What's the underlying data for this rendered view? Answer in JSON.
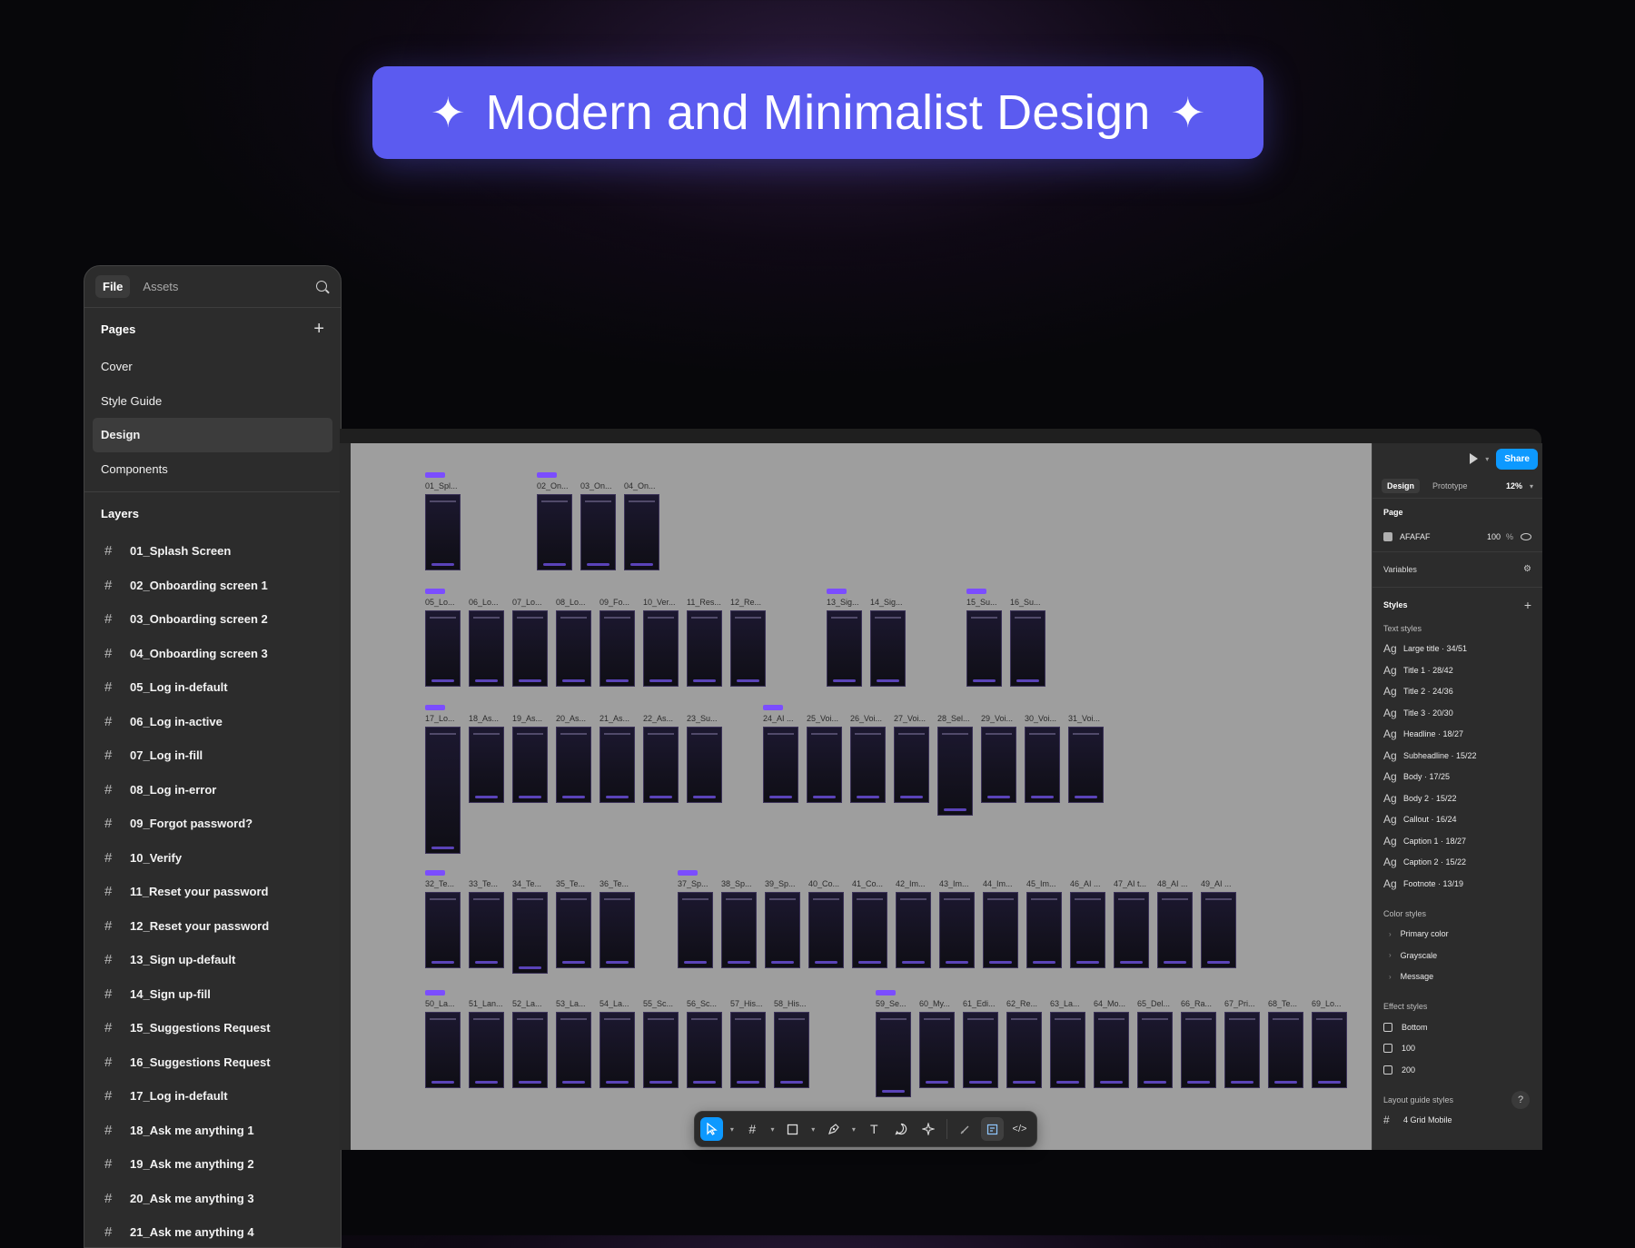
{
  "banner": {
    "title": "Modern and Minimalist Design",
    "spark_icon": "✦"
  },
  "left_panel": {
    "tabs": [
      "File",
      "Assets"
    ],
    "pages_heading": "Pages",
    "pages": [
      "Cover",
      "Style Guide",
      "Design",
      "Components"
    ],
    "active_page": "Design",
    "layers_heading": "Layers",
    "layers": [
      "01_Splash Screen",
      "02_Onboarding screen 1",
      "03_Onboarding screen 2",
      "04_Onboarding screen 3",
      "05_Log in-default",
      "06_Log in-active",
      "07_Log in-fill",
      "08_Log in-error",
      "09_Forgot password?",
      "10_Verify",
      "11_Reset your password",
      "12_Reset your password",
      "13_Sign up-default",
      "14_Sign up-fill",
      "15_Suggestions Request",
      "16_Suggestions Request",
      "17_Log in-default",
      "18_Ask me anything 1",
      "19_Ask me anything 2",
      "20_Ask me anything 3",
      "21_Ask me anything 4"
    ]
  },
  "canvas": {
    "rows": [
      [
        "01_Spl...",
        "02_On...",
        "03_On...",
        "04_On..."
      ],
      [
        "05_Lo...",
        "06_Lo...",
        "07_Lo...",
        "08_Lo...",
        "09_Fo...",
        "10_Ver...",
        "11_Res...",
        "12_Re...",
        "13_Sig...",
        "14_Sig...",
        "15_Su...",
        "16_Su..."
      ],
      [
        "17_Lo...",
        "18_As...",
        "19_As...",
        "20_As...",
        "21_As...",
        "22_As...",
        "23_Su...",
        "24_AI ...",
        "25_Voi...",
        "26_Voi...",
        "27_Voi...",
        "28_Sel...",
        "29_Voi...",
        "30_Voi...",
        "31_Voi..."
      ],
      [
        "32_Te...",
        "33_Te...",
        "34_Te...",
        "35_Te...",
        "36_Te...",
        "37_Sp...",
        "38_Sp...",
        "39_Sp...",
        "40_Co...",
        "41_Co...",
        "42_Im...",
        "43_Im...",
        "44_Im...",
        "45_Im...",
        "46_AI ...",
        "47_AI t...",
        "48_AI ...",
        "49_AI ..."
      ],
      [
        "50_La...",
        "51_Lan...",
        "52_La...",
        "53_La...",
        "54_La...",
        "55_Sc...",
        "56_Sc...",
        "57_His...",
        "58_His...",
        "59_Se...",
        "60_My...",
        "61_Edi...",
        "62_Re...",
        "63_La...",
        "64_Mo...",
        "65_Del...",
        "66_Ra...",
        "67_Pri...",
        "68_Te...",
        "69_Lo..."
      ]
    ]
  },
  "toolbar": {
    "tools": [
      "move-tool",
      "frame-tool",
      "shape-tool",
      "pen-tool",
      "text-tool",
      "comment-tool",
      "actions-tool",
      "draw-mode",
      "design-mode",
      "dev-mode"
    ],
    "text_tool_glyph": "T"
  },
  "right_panel": {
    "share_label": "Share",
    "tabs": [
      "Design",
      "Prototype"
    ],
    "zoom": "12%",
    "page_heading": "Page",
    "page_fill": {
      "hex": "AFAFAF",
      "opacity": "100",
      "unit": "%",
      "color": "#AFAFAF"
    },
    "variables_heading": "Variables",
    "styles_heading": "Styles",
    "text_styles_heading": "Text styles",
    "ag_glyph": "Ag",
    "text_styles": [
      "Large title · 34/51",
      "Title 1 · 28/42",
      "Title 2 · 24/36",
      "Title 3 · 20/30",
      "Headline · 18/27",
      "Subheadline · 15/22",
      "Body · 17/25",
      "Body 2 · 15/22",
      "Callout · 16/24",
      "Caption 1 · 18/27",
      "Caption 2 · 15/22",
      "Footnote · 13/19"
    ],
    "color_styles_heading": "Color styles",
    "color_styles": [
      "Primary color",
      "Grayscale",
      "Message"
    ],
    "effect_styles_heading": "Effect styles",
    "effect_styles": [
      "Bottom",
      "100",
      "200"
    ],
    "layout_guide_heading": "Layout guide styles",
    "layout_guides": [
      "4 Grid Mobile"
    ],
    "help_label": "?"
  },
  "colors": {
    "accent": "#5B5BF0",
    "frame_tag": "#7B4DFF",
    "share": "#0D99FF"
  }
}
